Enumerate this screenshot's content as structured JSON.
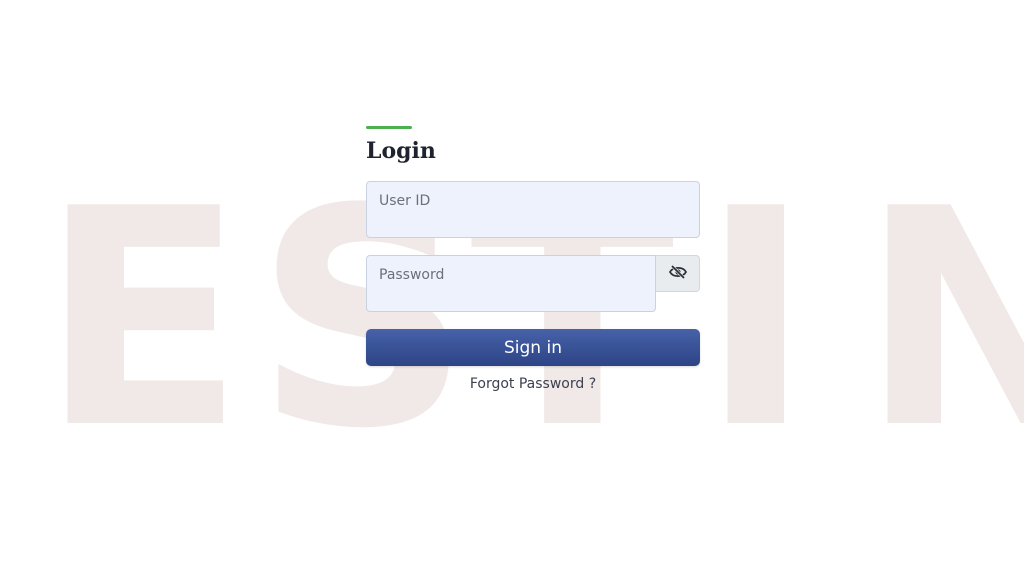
{
  "watermark": {
    "letters": [
      "E",
      "S",
      "T",
      "I",
      "N"
    ]
  },
  "login": {
    "title": "Login",
    "accent_color": "#4caf50",
    "user_id": {
      "placeholder": "User ID",
      "value": ""
    },
    "password": {
      "placeholder": "Password",
      "value": "",
      "toggle_icon": "eye-slash-icon"
    },
    "sign_in_label": "Sign in",
    "sign_in_color": "#34498f",
    "forgot_password_label": "Forgot Password ?"
  }
}
